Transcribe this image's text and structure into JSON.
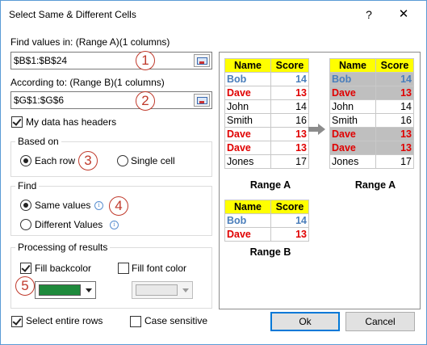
{
  "dialog": {
    "title": "Select Same & Different Cells",
    "help": "?",
    "close": "✕"
  },
  "range_a": {
    "label": "Find values in: (Range A)(1 columns)",
    "value": "$B$1:$B$24",
    "step": "1"
  },
  "range_b": {
    "label": "According to: (Range B)(1 columns)",
    "value": "$G$1:$G$6",
    "step": "2"
  },
  "headers_option": {
    "label": "My data has headers",
    "checked": true
  },
  "based_on": {
    "title": "Based on",
    "options": [
      "Each row",
      "Single cell"
    ],
    "selected": "Each row",
    "step": "3"
  },
  "find": {
    "title": "Find",
    "options": [
      "Same values",
      "Different Values"
    ],
    "selected": "Same values",
    "step": "4"
  },
  "processing": {
    "title": "Processing of results",
    "fill_backcolor": {
      "label": "Fill backcolor",
      "checked": true,
      "color": "#1f8a3c"
    },
    "fill_fontcolor": {
      "label": "Fill font color",
      "checked": false,
      "color": "#e8e8e8"
    },
    "step": "5"
  },
  "select_rows": {
    "label": "Select entire rows",
    "checked": true
  },
  "case_sensitive": {
    "label": "Case sensitive",
    "checked": false
  },
  "buttons": {
    "ok": "Ok",
    "cancel": "Cancel"
  },
  "preview": {
    "headers": [
      "Name",
      "Score"
    ],
    "range_a_rows": [
      [
        "Bob",
        "14"
      ],
      [
        "Dave",
        "13"
      ],
      [
        "John",
        "14"
      ],
      [
        "Smith",
        "16"
      ],
      [
        "Dave",
        "13"
      ],
      [
        "Dave",
        "13"
      ],
      [
        "Jones",
        "17"
      ]
    ],
    "range_b_rows": [
      [
        "Bob",
        "14"
      ],
      [
        "Dave",
        "13"
      ]
    ],
    "caption_a": "Range A",
    "caption_a_result": "Range A",
    "caption_b": "Range B",
    "colors": {
      "header": "#ffff00",
      "blue": "#4a7ebb",
      "red": "#e00000",
      "shade": "#bfbfbf"
    }
  }
}
